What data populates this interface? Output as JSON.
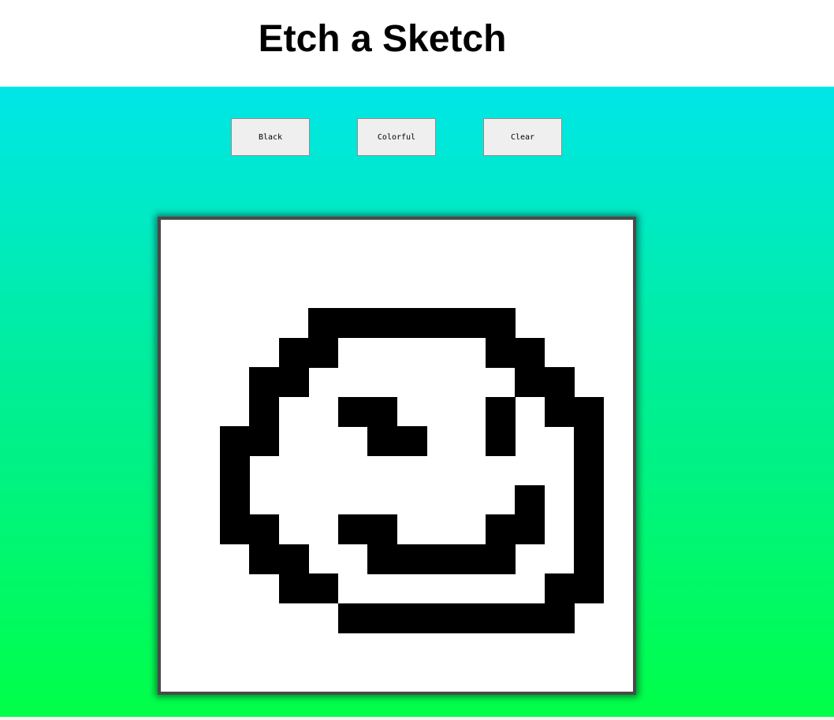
{
  "header": {
    "title": "Etch a Sketch"
  },
  "controls": {
    "black_label": "Black",
    "colorful_label": "Colorful",
    "clear_label": "Clear"
  },
  "board": {
    "grid_size": 16,
    "background_color": "#ffffff",
    "ink_color": "#000000",
    "filled_cells": [
      [
        3,
        5
      ],
      [
        3,
        6
      ],
      [
        3,
        7
      ],
      [
        3,
        8
      ],
      [
        3,
        9
      ],
      [
        3,
        10
      ],
      [
        3,
        11
      ],
      [
        4,
        4
      ],
      [
        4,
        5
      ],
      [
        4,
        11
      ],
      [
        4,
        12
      ],
      [
        5,
        3
      ],
      [
        5,
        4
      ],
      [
        5,
        12
      ],
      [
        5,
        13
      ],
      [
        6,
        3
      ],
      [
        6,
        6
      ],
      [
        6,
        7
      ],
      [
        6,
        11
      ],
      [
        6,
        13
      ],
      [
        6,
        14
      ],
      [
        7,
        2
      ],
      [
        7,
        3
      ],
      [
        7,
        7
      ],
      [
        7,
        8
      ],
      [
        7,
        11
      ],
      [
        7,
        14
      ],
      [
        8,
        2
      ],
      [
        8,
        14
      ],
      [
        9,
        2
      ],
      [
        9,
        12
      ],
      [
        9,
        14
      ],
      [
        10,
        2
      ],
      [
        10,
        3
      ],
      [
        10,
        6
      ],
      [
        10,
        7
      ],
      [
        10,
        11
      ],
      [
        10,
        12
      ],
      [
        10,
        14
      ],
      [
        11,
        3
      ],
      [
        11,
        4
      ],
      [
        11,
        7
      ],
      [
        11,
        8
      ],
      [
        11,
        9
      ],
      [
        11,
        10
      ],
      [
        11,
        11
      ],
      [
        11,
        14
      ],
      [
        12,
        4
      ],
      [
        12,
        5
      ],
      [
        12,
        13
      ],
      [
        12,
        14
      ],
      [
        13,
        6
      ],
      [
        13,
        7
      ],
      [
        13,
        8
      ],
      [
        13,
        9
      ],
      [
        13,
        10
      ],
      [
        13,
        11
      ],
      [
        13,
        12
      ],
      [
        13,
        13
      ]
    ]
  }
}
